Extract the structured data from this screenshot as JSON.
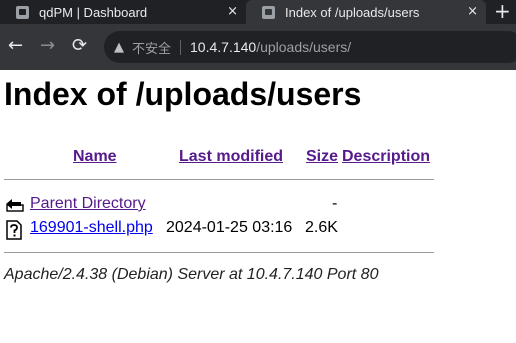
{
  "browser": {
    "tabs": [
      {
        "title": "qdPM | Dashboard",
        "close": "×"
      },
      {
        "title": "Index of /uploads/users",
        "close": "×"
      }
    ],
    "new_tab": "+",
    "nav": {
      "back": "←",
      "forward": "→",
      "reload": "⟳"
    },
    "address_bar": {
      "warning_icon": "▲",
      "security_label": "不安全",
      "host": "10.4.7.140",
      "path": "/uploads/users/"
    }
  },
  "page": {
    "heading": "Index of /uploads/users",
    "columns": {
      "name": "Name",
      "last_modified": "Last modified",
      "size": "Size",
      "description": "Description"
    },
    "rows": [
      {
        "name": "Parent Directory",
        "last_modified": "",
        "size": "-",
        "description": "",
        "icon": "back-folder-icon"
      },
      {
        "name": "169901-shell.php",
        "last_modified": "2024-01-25 03:16",
        "size": "2.6K",
        "description": "",
        "icon": "unknown-file-icon"
      }
    ],
    "server_signature": "Apache/2.4.38 (Debian) Server at 10.4.7.140 Port 80"
  }
}
